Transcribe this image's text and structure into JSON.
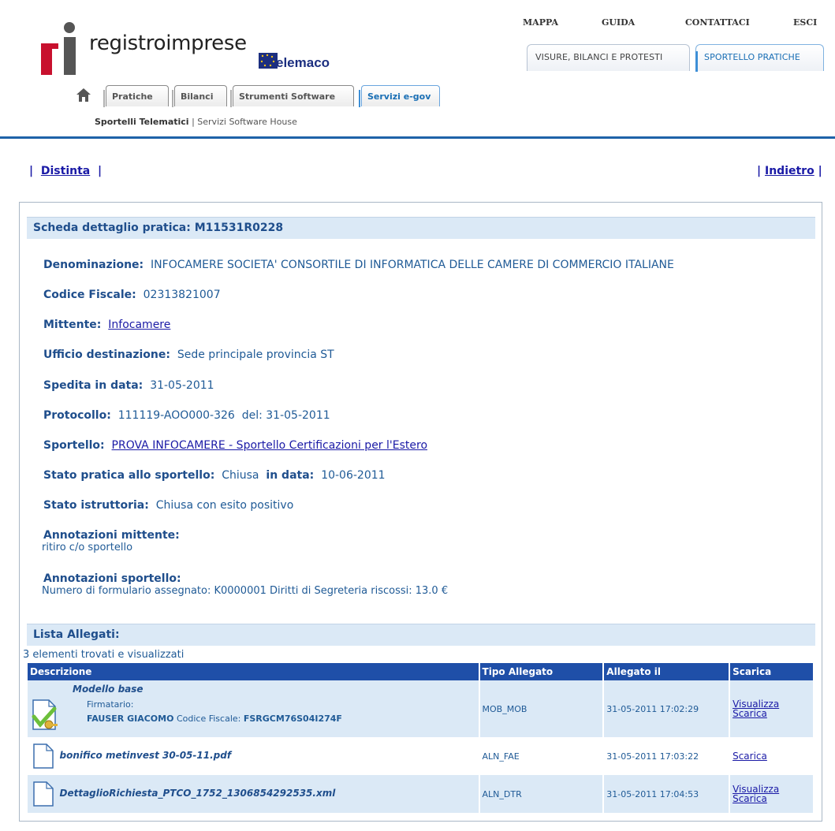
{
  "header": {
    "logo_text": "registroimprese",
    "telemaco_text": "elemaco",
    "top_links": {
      "mappa": "MAPPA",
      "guida": "GUIDA",
      "contattaci": "CONTATTACI",
      "esci": "ESCI"
    },
    "top_tabs": {
      "visure": "VISURE, BILANCI E PROTESTI",
      "sportello": "SPORTELLO PRATICHE"
    },
    "section_tabs": {
      "pratiche": "Pratiche",
      "bilanci": "Bilanci",
      "strumenti": "Strumenti Software",
      "servizi": "Servizi e-gov"
    },
    "subnav": {
      "active": "Sportelli Telematici",
      "separator": " | ",
      "other": "Servizi Software House"
    }
  },
  "nav": {
    "distinta": "Distinta",
    "indietro": "Indietro",
    "bar": "|"
  },
  "scheda": {
    "title": "Scheda dettaglio pratica: M11531R0228",
    "denominazione_label": "Denominazione:",
    "denominazione": "INFOCAMERE SOCIETA' CONSORTILE DI INFORMATICA DELLE CAMERE DI COMMERCIO ITALIANE",
    "codice_fiscale_label": "Codice Fiscale:",
    "codice_fiscale": "02313821007",
    "mittente_label": "Mittente:",
    "mittente": "Infocamere",
    "ufficio_label": "Ufficio destinazione:",
    "ufficio": "Sede principale provincia ST",
    "spedita_label": "Spedita in data:",
    "spedita": "31-05-2011",
    "protocollo_label": "Protocollo:",
    "protocollo": "111119-AOO000-326",
    "protocollo_del_label": "del:",
    "protocollo_del": "31-05-2011",
    "sportello_label": "Sportello:",
    "sportello": "PROVA INFOCAMERE - Sportello Certificazioni per l'Estero",
    "stato_label": "Stato pratica allo sportello:",
    "stato": "Chiusa",
    "stato_data_label": "in data:",
    "stato_data": "10-06-2011",
    "istruttoria_label": "Stato istruttoria:",
    "istruttoria": "Chiusa con esito positivo",
    "ann_mittente_label": "Annotazioni mittente:",
    "ann_mittente": "ritiro c/o sportello",
    "ann_sportello_label": "Annotazioni sportello:",
    "ann_sportello": "Numero di formulario assegnato: K0000001 Diritti di Segreteria riscossi: 13.0 €"
  },
  "allegati": {
    "title": "Lista Allegati:",
    "count_text": "3 elementi trovati e visualizzati",
    "columns": [
      "Descrizione",
      "Tipo Allegato",
      "Allegato il",
      "Scarica"
    ],
    "rows": [
      {
        "name": "Modello base",
        "firmatario_label": "Firmatario:",
        "firmatario": "FAUSER GIACOMO",
        "cf_label": "Codice Fiscale:",
        "cf": "FSRGCM76S04I274F",
        "tipo": "MOB_MOB",
        "data": "31-05-2011 17:02:29",
        "visualizza": "Visualizza",
        "scarica": "Scarica"
      },
      {
        "name": "bonifico metinvest 30-05-11.pdf",
        "tipo": "ALN_FAE",
        "data": "31-05-2011 17:03:22",
        "scarica": "Scarica"
      },
      {
        "name": "DettaglioRichiesta_PTCO_1752_1306854292535.xml",
        "tipo": "ALN_DTR",
        "data": "31-05-2011 17:04:53",
        "visualizza": "Visualizza",
        "scarica": "Scarica"
      }
    ]
  },
  "colors": {
    "brand_blue": "#1e63a8",
    "header_row": "#1f4fa8",
    "section_bg": "#dbe9f6",
    "logo_red": "#c8102e"
  }
}
